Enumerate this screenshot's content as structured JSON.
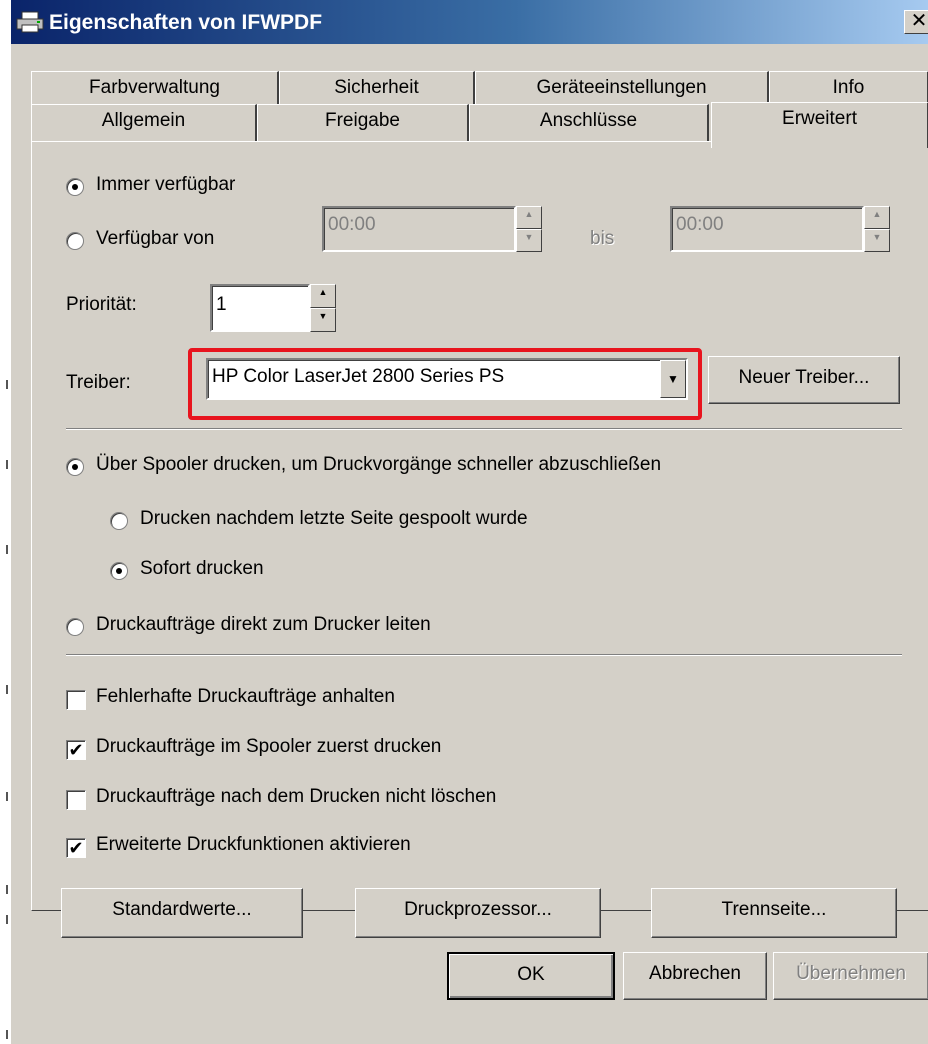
{
  "window": {
    "title": "Eigenschaften von IFWPDF",
    "close_glyph": "✕"
  },
  "tabs": {
    "row1": [
      {
        "label": "Farbverwaltung"
      },
      {
        "label": "Sicherheit"
      },
      {
        "label": "Geräteeinstellungen"
      },
      {
        "label": "Info"
      }
    ],
    "row2": [
      {
        "label": "Allgemein"
      },
      {
        "label": "Freigabe"
      },
      {
        "label": "Anschlüsse"
      },
      {
        "label": "Erweitert",
        "active": true
      }
    ]
  },
  "availability": {
    "always_label": "Immer verfügbar",
    "always_selected": true,
    "from_label": "Verfügbar von",
    "from_time": "00:00",
    "bis_label": "bis",
    "to_time": "00:00"
  },
  "priority": {
    "label": "Priorität:",
    "value": "1"
  },
  "driver": {
    "label": "Treiber:",
    "selected": "HP Color LaserJet 2800 Series PS",
    "new_driver_button": "Neuer Treiber..."
  },
  "spooling": {
    "spool_label": "Über Spooler drucken, um Druckvorgänge schneller abzuschließen",
    "spool_selected": true,
    "after_last_page_label": "Drucken nachdem letzte Seite gespoolt wurde",
    "immediately_label": "Sofort drucken",
    "immediately_selected": true,
    "direct_label": "Druckaufträge direkt zum Drucker leiten"
  },
  "checkboxes": [
    {
      "label": "Fehlerhafte Druckaufträge anhalten",
      "checked": false
    },
    {
      "label": "Druckaufträge im Spooler zuerst drucken",
      "checked": true
    },
    {
      "label": "Druckaufträge nach dem Drucken nicht löschen",
      "checked": false
    },
    {
      "label": "Erweiterte Druckfunktionen aktivieren",
      "checked": true
    }
  ],
  "panel_buttons": {
    "defaults": "Standardwerte...",
    "processor": "Druckprozessor...",
    "separator": "Trennseite..."
  },
  "dialog_buttons": {
    "ok": "OK",
    "cancel": "Abbrechen",
    "apply": "Übernehmen"
  },
  "colors": {
    "highlight": "#e8141e",
    "titlebar": "#0a246a"
  },
  "icons": {
    "app": "printer-icon",
    "dropdown": "dropdown-arrow-icon",
    "spin": "spin-arrows-icon"
  }
}
